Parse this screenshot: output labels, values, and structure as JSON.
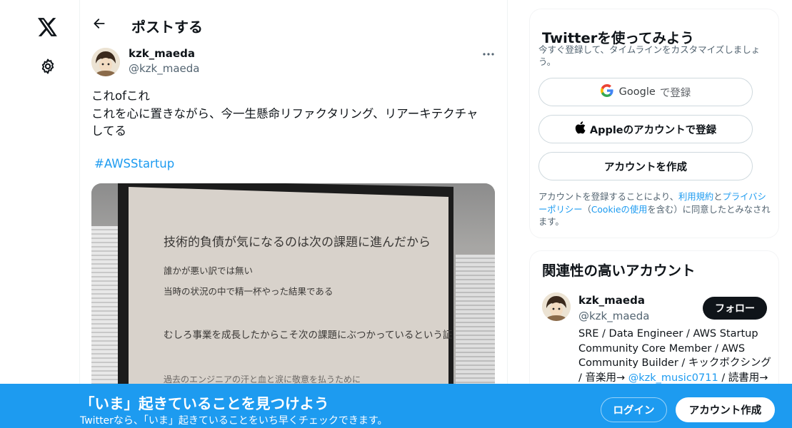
{
  "nav": {
    "logo_icon": "x-logo-icon",
    "settings_icon": "gear-icon"
  },
  "header": {
    "back_icon": "arrow-left-icon",
    "title": "ポストする"
  },
  "post": {
    "author_name": "kzk_maeda",
    "author_handle": "@kzk_maeda",
    "more_icon": "more-dots-icon",
    "text_lines": [
      "これofこれ",
      "これを心に置きながら、今一生懸命リファクタリング、リアーキテクチャ",
      "してる"
    ],
    "hashtag": "#AWSStartup",
    "image_slide_lines": [
      "技術的負債が気になるのは次の課題に進んだから",
      "誰かが悪い訳では無い",
      "当時の状況の中で精一杯やった結果である",
      "むしろ事業を成長したからこそ次の課題にぶつかっているという証",
      "過去のエンジニアの汗と血と涙に敬意を払うために"
    ]
  },
  "signup_card": {
    "title": "Twitterを使ってみよう",
    "subtitle": "今すぐ登録して、タイムラインをカスタマイズしましょう。",
    "google_label": "Google",
    "google_suffix": "で登録",
    "apple_label": "Appleのアカウントで登録",
    "create_label": "アカウントを作成",
    "terms_prefix": "アカウントを登録することにより、",
    "terms_link": "利用規約",
    "terms_and": "と",
    "privacy_link": "プライバシーポリシー",
    "terms_paren_open": "（",
    "cookie_link": "Cookieの使用",
    "terms_suffix": "を含む）に同意したとみなされます。"
  },
  "related": {
    "title": "関連性の高いアカウント",
    "name": "kzk_maeda",
    "handle": "@kzk_maeda",
    "follow_label": "フォロー",
    "bio_lines": [
      "SRE / Data Engineer / AWS Startup",
      "Community Core Member / AWS",
      "Community Builder / キックボクシング",
      "/ 音楽用→"
    ],
    "bio_link": "@kzk_music0711",
    "bio_tail": "/ 読書用→"
  },
  "banner": {
    "title": "「いま」起きていることを見つけよう",
    "subtitle": "Twitterなら、「いま」起きていることをいち早くチェックできます。",
    "login_label": "ログイン",
    "signup_label": "アカウント作成"
  },
  "colors": {
    "accent": "#1d9bf0",
    "text": "#0f1419",
    "secondary": "#536471"
  }
}
